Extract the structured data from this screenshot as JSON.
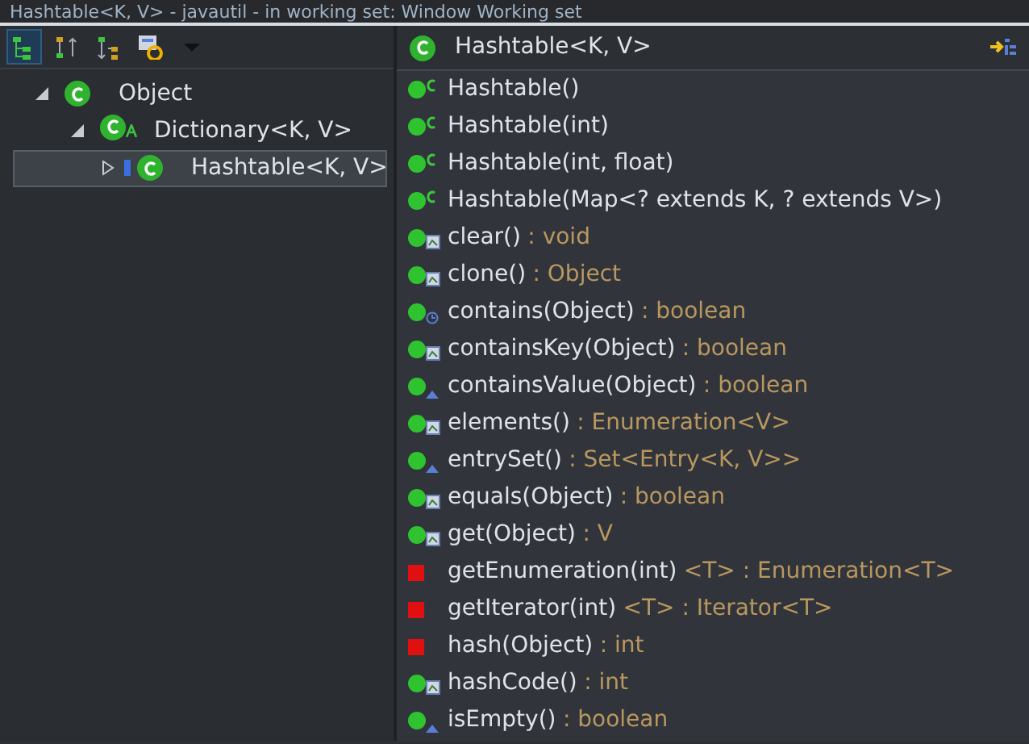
{
  "window": {
    "title": "Hashtable<K, V> - javautil - in working set: Window Working set"
  },
  "hierarchy": {
    "toolbar": [
      {
        "kind": "type-hierarchy",
        "selected": true
      },
      {
        "kind": "supertype",
        "selected": false
      },
      {
        "kind": "subtype",
        "selected": false
      },
      {
        "kind": "history",
        "selected": false
      },
      {
        "kind": "dropdown",
        "selected": false
      }
    ],
    "tree": [
      {
        "label": "Object",
        "expanded": true,
        "selected": false,
        "abstract": false,
        "focus": false,
        "children": [
          {
            "label": "Dictionary<K, V>",
            "expanded": true,
            "selected": false,
            "abstract": true,
            "focus": false,
            "children": [
              {
                "label": "Hashtable<K, V>",
                "expanded": false,
                "selected": true,
                "abstract": false,
                "focus": true
              }
            ]
          }
        ]
      }
    ]
  },
  "members": {
    "title": "Hashtable<K, V>",
    "items": [
      {
        "name": "Hashtable()",
        "kind": "constructor",
        "private": false
      },
      {
        "name": "Hashtable(int)",
        "kind": "constructor",
        "private": false
      },
      {
        "name": "Hashtable(int, float)",
        "kind": "constructor",
        "private": false
      },
      {
        "name": "Hashtable(Map<? extends K, ? extends V>)",
        "kind": "constructor",
        "private": false
      },
      {
        "name": "clear()",
        "type": ": void",
        "kind": "override",
        "private": false
      },
      {
        "name": "clone()",
        "type": ": Object",
        "kind": "override",
        "private": false
      },
      {
        "name": "contains(Object)",
        "type": ": boolean",
        "kind": "sync",
        "private": false
      },
      {
        "name": "containsKey(Object)",
        "type": ": boolean",
        "kind": "override",
        "private": false
      },
      {
        "name": "containsValue(Object)",
        "type": ": boolean",
        "kind": "implements",
        "private": false
      },
      {
        "name": "elements()",
        "type": ": Enumeration<V>",
        "kind": "override",
        "private": false
      },
      {
        "name": "entrySet()",
        "type": ": Set<Entry<K, V>>",
        "kind": "implements",
        "private": false
      },
      {
        "name": "equals(Object)",
        "type": ": boolean",
        "kind": "override",
        "private": false
      },
      {
        "name": "get(Object)",
        "type": ": V",
        "kind": "override",
        "private": false
      },
      {
        "name": "getEnumeration(int)",
        "type": "<T> : Enumeration<T>",
        "kind": "plain",
        "private": true
      },
      {
        "name": "getIterator(int)",
        "type": "<T> : Iterator<T>",
        "kind": "plain",
        "private": true
      },
      {
        "name": "hash(Object)",
        "type": ": int",
        "kind": "plain",
        "private": true
      },
      {
        "name": "hashCode()",
        "type": ": int",
        "kind": "override",
        "private": false
      },
      {
        "name": "isEmpty()",
        "type": ": boolean",
        "kind": "implements",
        "private": false
      }
    ]
  }
}
